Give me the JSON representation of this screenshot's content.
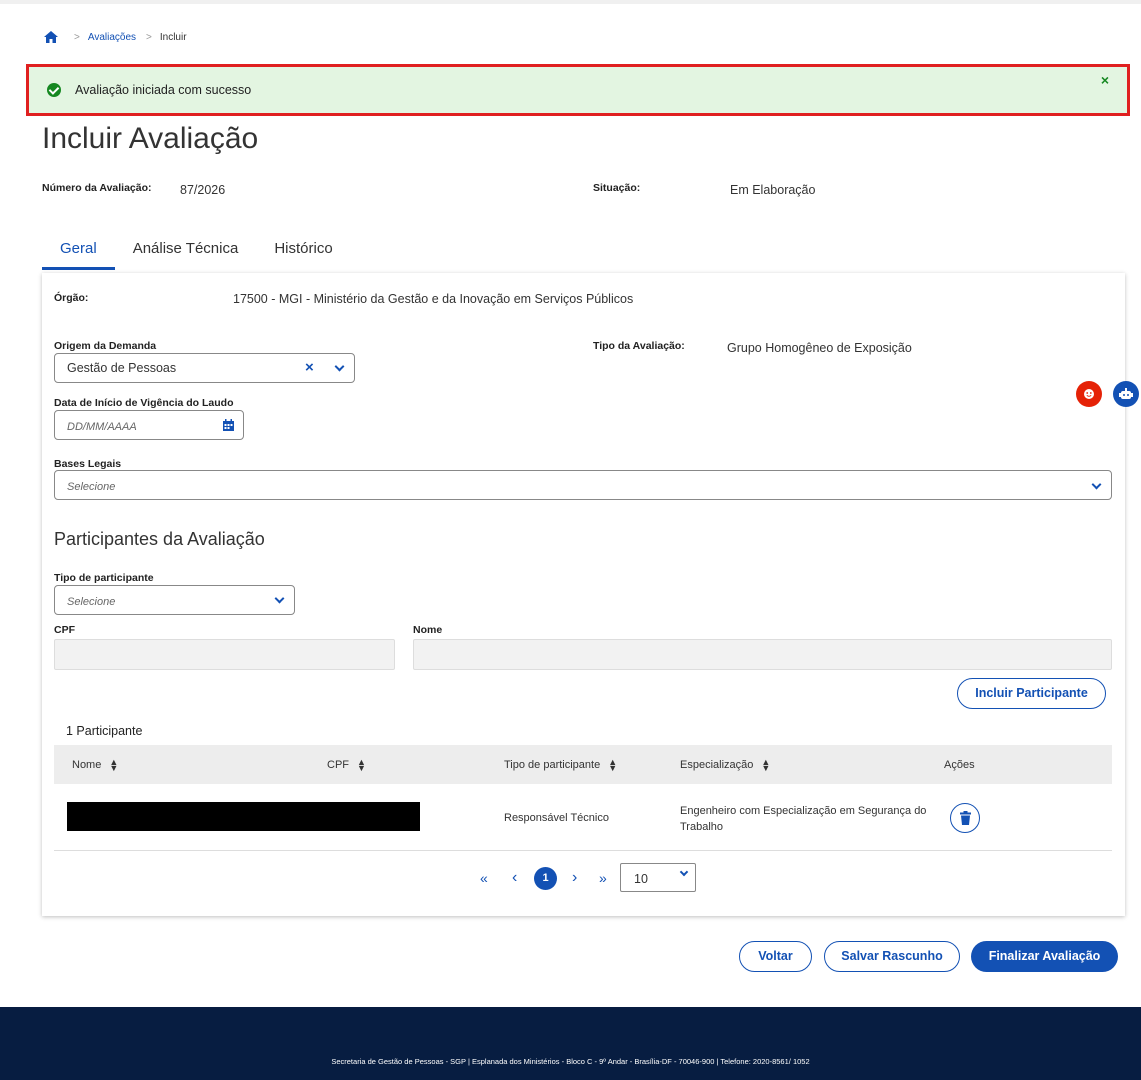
{
  "breadcrumb": {
    "items": [
      "Avaliações",
      "Incluir"
    ]
  },
  "alert": {
    "message": "Avaliação iniciada com sucesso",
    "close": "×"
  },
  "page": {
    "title": "Incluir Avaliação",
    "numero_label": "Número da Avaliação:",
    "numero_value": "87/2026",
    "situacao_label": "Situação:",
    "situacao_value": "Em Elaboração"
  },
  "tabs": [
    {
      "label": "Geral",
      "active": true
    },
    {
      "label": "Análise Técnica",
      "active": false
    },
    {
      "label": "Histórico",
      "active": false
    }
  ],
  "form": {
    "orgao_label": "Órgão:",
    "orgao_value": "17500 - MGI - Ministério da Gestão e da Inovação em Serviços Públicos",
    "origem_label": "Origem da Demanda",
    "origem_value": "Gestão de Pessoas",
    "tipo_label": "Tipo da Avaliação:",
    "tipo_value": "Grupo Homogêneo de Exposição",
    "data_label": "Data de Início de Vigência do Laudo",
    "data_placeholder": "DD/MM/AAAA",
    "bases_label": "Bases Legais",
    "bases_placeholder": "Selecione"
  },
  "participantes": {
    "section_title": "Participantes da Avaliação",
    "tipo_label": "Tipo de participante",
    "tipo_placeholder": "Selecione",
    "cpf_label": "CPF",
    "nome_label": "Nome",
    "incluir_button": "Incluir Participante",
    "count_label": "1 Participante",
    "columns": [
      "Nome",
      "CPF",
      "Tipo de participante",
      "Especialização",
      "Ações"
    ],
    "rows": [
      {
        "nome": "",
        "cpf": "",
        "tipo": "Responsável Técnico",
        "especializacao_line1": "Engenheiro com Especialização em Segurança do",
        "especializacao_line2": "Trabalho"
      }
    ]
  },
  "pagination": {
    "first": "«",
    "prev": "‹",
    "current": "1",
    "next": "›",
    "last": "»",
    "page_size": "10"
  },
  "actions": {
    "voltar": "Voltar",
    "salvar": "Salvar Rascunho",
    "finalizar": "Finalizar Avaliação"
  },
  "footer": {
    "text": "Secretaria de Gestão de Pessoas - SGP | Esplanada dos Ministérios - Bloco C - 9º Andar - Brasília-DF - 70046-900 | Telefone: 2020-8561/ 1052"
  },
  "colors": {
    "primary": "#1351b4",
    "success": "#168821",
    "alert_bg": "#e3f5e1",
    "footer_bg": "#071d41",
    "highlight": "#e02020"
  }
}
